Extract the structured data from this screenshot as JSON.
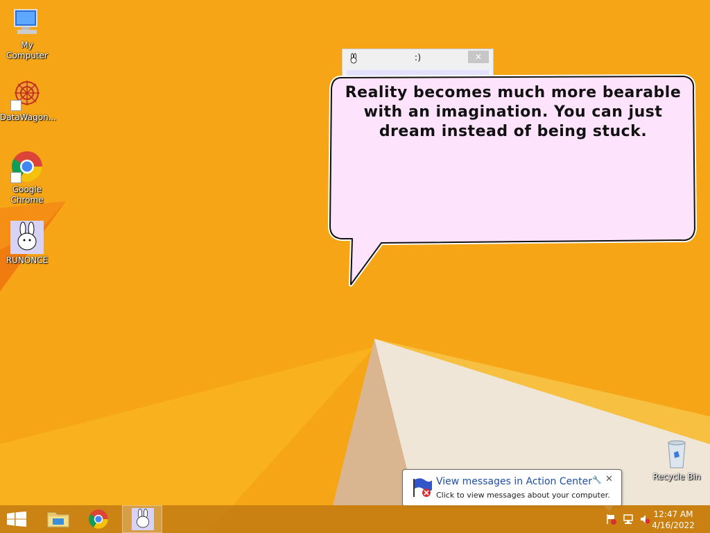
{
  "desktop": {
    "icons": [
      {
        "label": "My Computer",
        "icon": "computer-icon"
      },
      {
        "label": "DataWagon...",
        "icon": "datawagon-icon"
      },
      {
        "label": "Google Chrome",
        "icon": "chrome-icon"
      },
      {
        "label": "RUNONCE",
        "icon": "bunny-icon"
      }
    ],
    "recycle_bin": {
      "label": "Recycle Bin",
      "icon": "recycle-bin-icon"
    }
  },
  "mini_window": {
    "title": ":)",
    "close_label": "✕"
  },
  "speech_bubble": {
    "text": "Reality becomes much more bearable with an imagination. You can just dream instead of being stuck."
  },
  "notification": {
    "title": "View messages in Action Center",
    "message": "Click to view messages about your computer.",
    "close_label": "✕",
    "settings_icon": "wrench-icon"
  },
  "taskbar": {
    "start_icon": "windows-logo-icon",
    "pinned": [
      {
        "name": "file-explorer",
        "icon": "folder-icon",
        "active": false
      },
      {
        "name": "chrome",
        "icon": "chrome-icon",
        "active": false
      },
      {
        "name": "runonce",
        "icon": "bunny-icon",
        "active": true
      }
    ],
    "tray": [
      "action-center-icon",
      "network-icon",
      "volume-muted-icon"
    ],
    "clock": {
      "time": "12:47 AM",
      "date": "4/16/2022"
    }
  },
  "colors": {
    "wallpaper_orange": "#f5a417",
    "bubble_fill": "#fde3fb",
    "link_blue": "#1d4fa6"
  }
}
